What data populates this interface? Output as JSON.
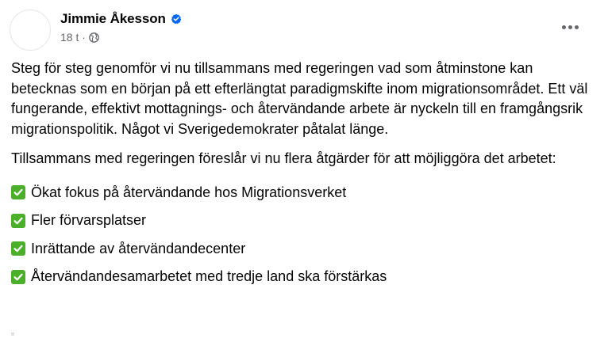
{
  "post": {
    "author": {
      "name": "Jimmie Åkesson",
      "verified": true,
      "verified_icon": "verified-badge-icon"
    },
    "meta": {
      "time": "18 t",
      "separator": "·",
      "audience_icon": "globe-icon"
    },
    "more_icon": "more-horizontal-icon",
    "paragraphs": [
      "Steg för steg genomför vi nu tillsammans med regeringen vad som åtminstone kan betecknas som en början på ett efterlängtat paradigmskifte inom migrationsområdet. Ett väl fungerande, effektivt mottagnings- och återvändande arbete är nyckeln till en framgångsrik migrationspolitik. Något vi Sverigedemokrater påtalat länge.",
      "Tillsammans med regeringen föreslår vi nu flera åtgärder för att möjliggöra det arbetet:"
    ],
    "bullets": [
      "Ökat fokus på återvändande hos Migrationsverket",
      "Fler förvarsplatser",
      "Inrättande av återvändandecenter",
      "Återvändandesamarbetet med tredje land ska förstärkas"
    ],
    "bullet_icon": "check-mark-emoji-icon"
  },
  "colors": {
    "text": "#050505",
    "secondary_text": "#65676b",
    "verified_blue": "#0866ff",
    "check_green": "#4caf2a"
  }
}
